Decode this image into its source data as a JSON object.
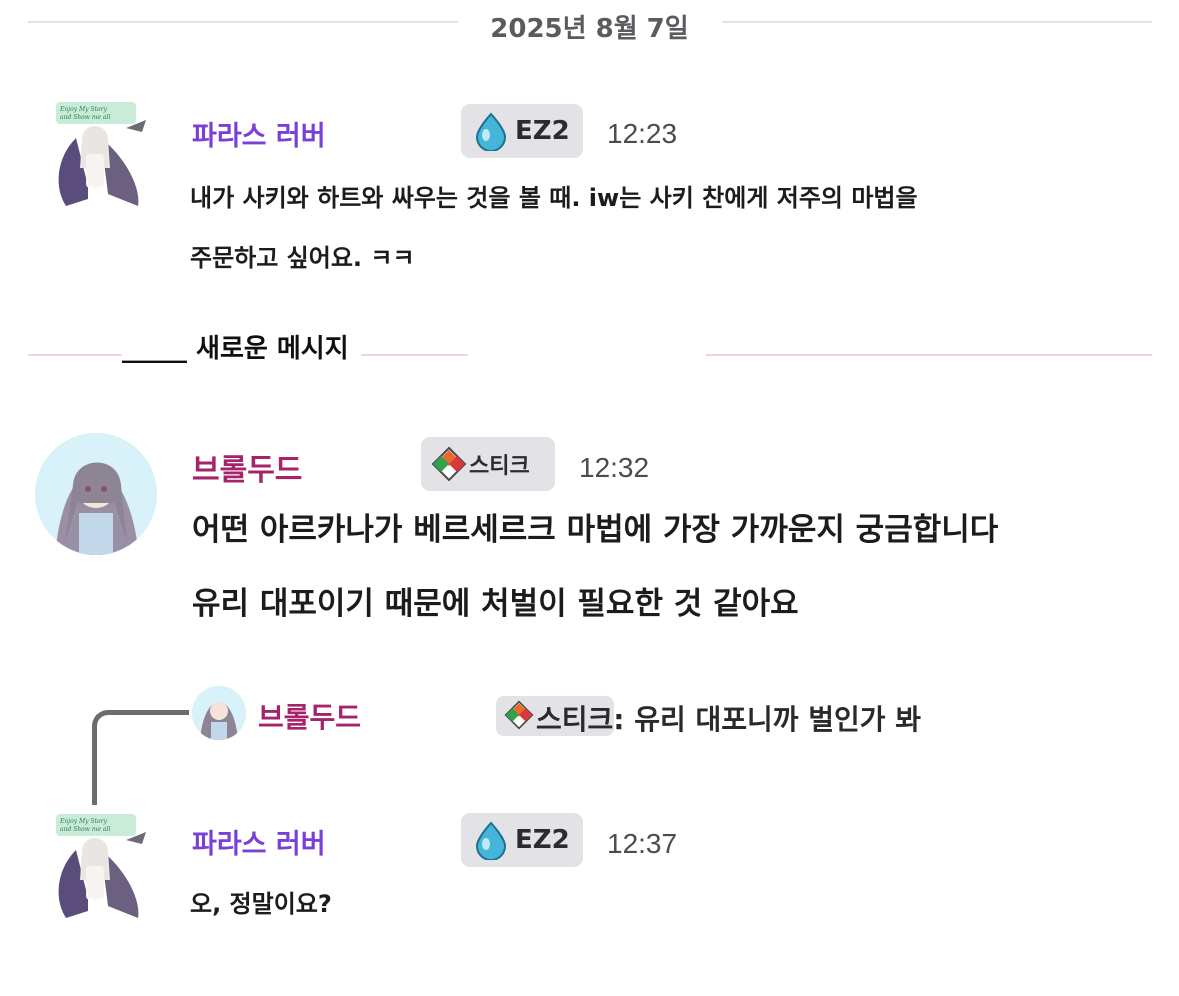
{
  "date_divider": "2025년 8월 7일",
  "new_messages_label": "_____ 새로운 메시지",
  "colors": {
    "parasu_name": "#7a3fd6",
    "brodudu_name": "#a6236b",
    "badge_bg": "#e3e3e7",
    "divider": "#e3e3e6",
    "new_divider": "#f3d4d9"
  },
  "messages": [
    {
      "author": "파라스 러버",
      "badge_icon": "water-drop-icon",
      "badge_label": "EZ2",
      "time": "12:23",
      "lines": [
        "내가 사키와 하트와 싸우는 것을 볼 때. iw는 사키 찬에게 저주의 마법을",
        "주문하고 싶어요. ㅋㅋ"
      ]
    },
    {
      "author": "브롤두드",
      "badge_icon": "diamond-sticker-icon",
      "badge_label": "스티크",
      "time": "12:32",
      "lines": [
        "어떤 아르카나가 베르세르크 마법에 가장 가까운지 궁금합니다",
        "유리 대포이기 때문에 처벌이 필요한 것 같아요"
      ]
    },
    {
      "reply_to": {
        "author": "브롤두드",
        "badge_icon": "diamond-sticker-icon",
        "badge_label": "스티크",
        "text": ": 유리 대포니까 벌인가 봐"
      },
      "author": "파라스 러버",
      "badge_icon": "water-drop-icon",
      "badge_label": "EZ2",
      "time": "12:37",
      "lines": [
        "오, 정말이요?"
      ]
    }
  ]
}
